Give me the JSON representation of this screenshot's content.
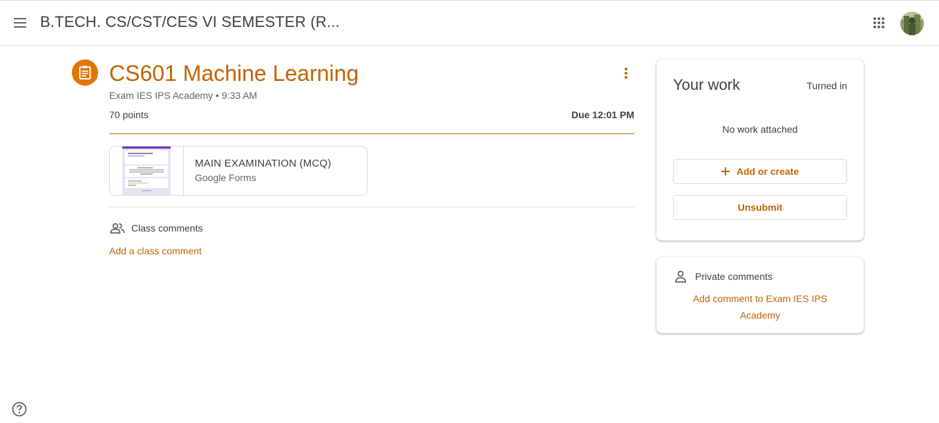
{
  "colors": {
    "accent": "#c26401",
    "accent_icon_bg": "#e37400",
    "divider": "#dadce0"
  },
  "header": {
    "menu_icon": "hamburger-menu-icon",
    "title": "B.TECH. CS/CST/CES VI SEMESTER (R...",
    "apps_icon": "apps-grid-icon",
    "avatar_icon": "account-avatar"
  },
  "assignment": {
    "icon": "assignment-icon",
    "title": "CS601 Machine Learning",
    "meta": "Exam IES IPS Academy • 9:33 AM",
    "points": "70 points",
    "due": "Due 12:01 PM",
    "more_icon": "more-vert-icon"
  },
  "attachment": {
    "title": "MAIN EXAMINATION (MCQ)",
    "type": "Google Forms"
  },
  "class_comments": {
    "icon": "people-icon",
    "label": "Class comments",
    "add_link": "Add a class comment"
  },
  "your_work": {
    "title": "Your work",
    "status": "Turned in",
    "empty_text": "No work attached",
    "add_button": "Add or create",
    "unsubmit_button": "Unsubmit"
  },
  "private_comments": {
    "icon": "person-icon",
    "label": "Private comments",
    "add_link": "Add comment to Exam IES IPS Academy"
  },
  "help": {
    "icon": "help-icon"
  }
}
